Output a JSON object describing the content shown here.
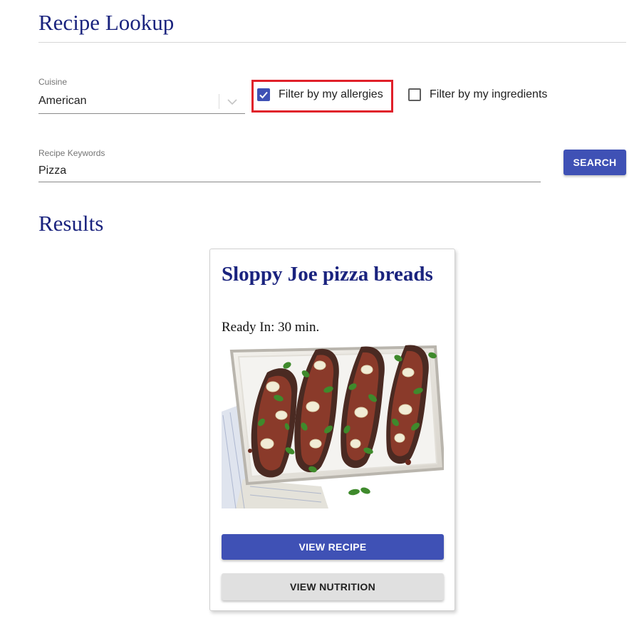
{
  "header": {
    "title": "Recipe Lookup"
  },
  "cuisine": {
    "label": "Cuisine",
    "value": "American"
  },
  "filters": {
    "allergies": {
      "label": "Filter by my allergies",
      "checked": true
    },
    "ingredients": {
      "label": "Filter by my ingredients",
      "checked": false
    }
  },
  "keywords": {
    "label": "Recipe Keywords",
    "value": "Pizza"
  },
  "search": {
    "label": "SEARCH"
  },
  "results": {
    "heading": "Results",
    "cards": [
      {
        "title": "Sloppy Joe pizza breads",
        "ready_label": "Ready In:",
        "ready_value": "30 min.",
        "image_alt": "tray of aubergine pizza boats topped with mince, mozzarella and basil",
        "view_recipe_label": "VIEW RECIPE",
        "view_nutrition_label": "VIEW NUTRITION"
      }
    ]
  },
  "colors": {
    "accent": "#3f51b5",
    "heading": "#1a237e",
    "highlight": "#e0202a",
    "secondary_button": "#e0e0e0"
  },
  "icons": {
    "dropdown": "chevron-down-icon",
    "checked": "checkmark-icon"
  }
}
